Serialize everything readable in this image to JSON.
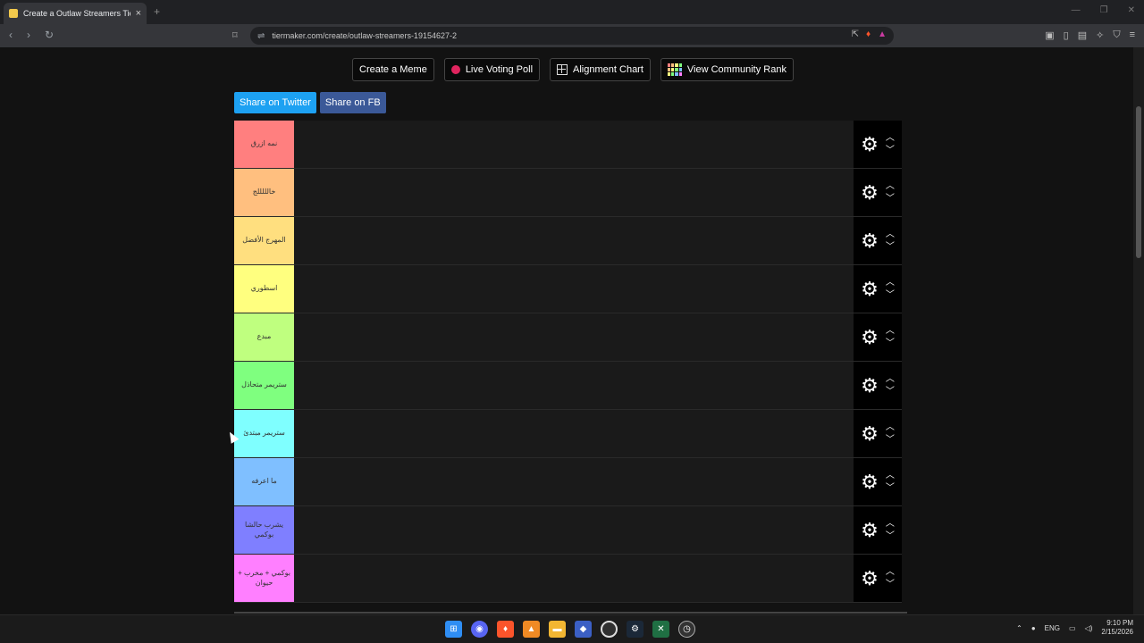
{
  "browser": {
    "tab_title": "Create a Outlaw Streamers Tier List",
    "new_tab": "+",
    "close": "×",
    "url": "tiermaker.com/create/outlaw-streamers-19154627-2"
  },
  "topbar": {
    "create_meme": "Create a Meme",
    "live_poll": "Live Voting Poll",
    "alignment": "Alignment Chart",
    "community": "View Community Rank"
  },
  "share": {
    "twitter": "Share on Twitter",
    "fb": "Share on FB"
  },
  "tiers": [
    {
      "label": "نمه ازرق",
      "color": "#ff7f7f"
    },
    {
      "label": "خالللللج",
      "color": "#ffbf7f"
    },
    {
      "label": "المهرج الأفضل",
      "color": "#ffdf7f"
    },
    {
      "label": "اسطوري",
      "color": "#ffff7f"
    },
    {
      "label": "مبدع",
      "color": "#bfff7f"
    },
    {
      "label": "ستريمر متحاذل",
      "color": "#7fff7f"
    },
    {
      "label": "ستريمر مبتدئ",
      "color": "#7fffff"
    },
    {
      "label": "ما اعرفه",
      "color": "#7fbfff"
    },
    {
      "label": "يشرب حالشا بوكمي",
      "color": "#7f7fff"
    },
    {
      "label": "بوكمي + مخرب + حيوان",
      "color": "#ff7fff"
    }
  ],
  "taskbar": {
    "lang": "ENG",
    "time": "9:10 PM",
    "date": "2/15/2026"
  }
}
